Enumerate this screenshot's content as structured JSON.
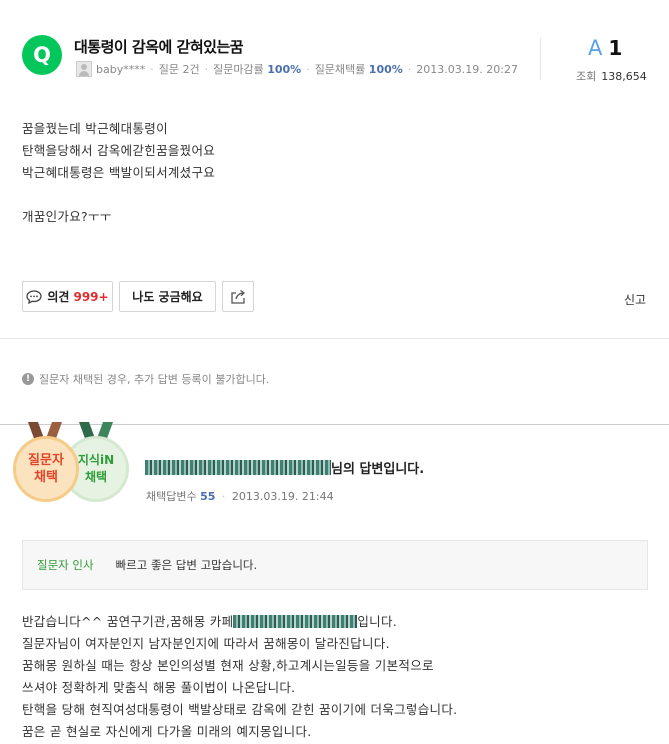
{
  "question": {
    "badge": "Q",
    "title": "대통령이 감옥에 갇혀있는꿈",
    "author": "baby****",
    "meta": {
      "question_label": "질문",
      "question_count": "2건",
      "close_rate_label": "질문마감률",
      "close_rate": "100%",
      "adopt_rate_label": "질문채택률",
      "adopt_rate": "100%",
      "date": "2013.03.19. 20:27"
    },
    "answer_count_mark": "A",
    "answer_count": "1",
    "views_label": "조회",
    "views": "138,654",
    "body": "꿈을꿨는데 박근혜대통령이\n탄핵을당해서 감옥에갇힌꿈을꿨어요\n박근혜대통령은 백발이되서계셨구요\n\n개꿈인가요?ㅜㅜ"
  },
  "actions": {
    "opinion_label": "의견",
    "opinion_count": "999+",
    "curious_label": "나도 궁금해요",
    "share_icon": "share-icon",
    "report_label": "신고"
  },
  "notice": "질문자 채택된 경우, 추가 답변 등록이 불가합니다.",
  "answer": {
    "medal_asker_line1": "질문자",
    "medal_asker_line2": "채택",
    "medal_kin_line1": "지식iN",
    "medal_kin_line2": "채택",
    "answerer_suffix": "님의 답변입니다.",
    "adopted_answers_label": "채택답변수",
    "adopted_answers": "55",
    "date": "2013.03.19. 21:44",
    "greeting_label": "질문자 인사",
    "greeting_text": "빠르고 좋은 답변 고맙습니다.",
    "body_lines": {
      "l1a": "반갑습니다^^ 꿈연구기관,꿈해몽 카페",
      "l1b": "입니다.",
      "l2": "질문자님이 여자분인지 남자분인지에 따라서 꿈해몽이 달라진답니다.",
      "l3": "꿈해몽 원하실 때는 항상 본인의성별 현재 상황,하고계시는일등을 기본적으로",
      "l4": "쓰셔야 정확하게 맞춤식 해몽 풀이법이 나온답니다.",
      "l5": "탄핵을 당해 현직여성대통령이 백발상태로 감옥에 갇힌 꿈이기에 더욱그렇습니다.",
      "l6": "꿈은 곧 현실로 자신에게 다가올 미래의 예지몽입니다."
    }
  },
  "colors": {
    "brand_green": "#03c75a",
    "accent_red": "#e02f2f",
    "meta_blue": "#4a6fb0",
    "answer_mark_blue": "#5aa0e8"
  }
}
